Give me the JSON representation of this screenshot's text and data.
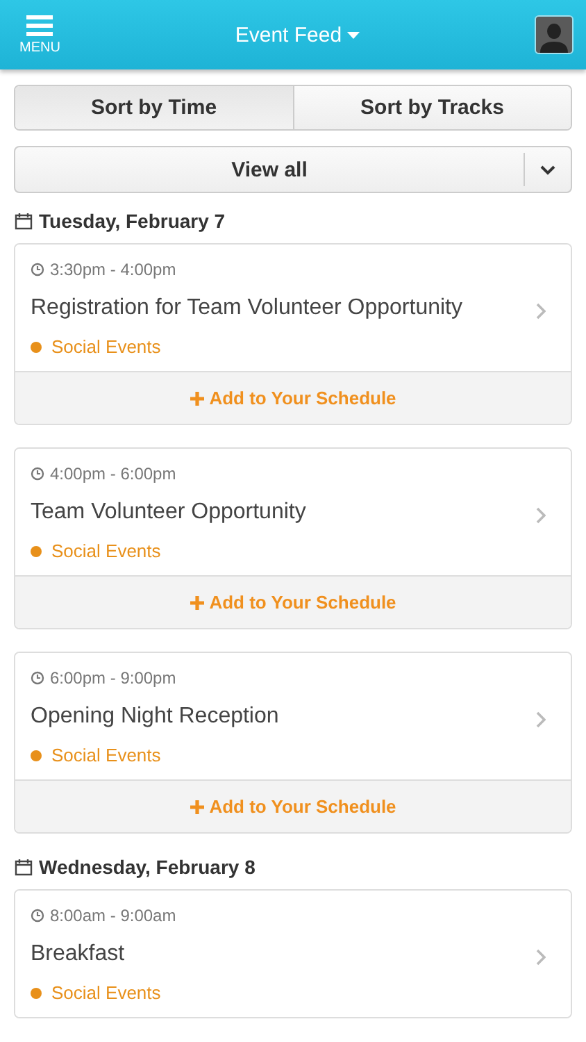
{
  "header": {
    "menu_label": "MENU",
    "title": "Event Feed"
  },
  "sort_tabs": [
    {
      "label": "Sort by Time",
      "selected": true
    },
    {
      "label": "Sort by Tracks",
      "selected": false
    }
  ],
  "filter": {
    "value": "View all"
  },
  "days": [
    {
      "date": "Tuesday, February 7",
      "events": [
        {
          "time": "3:30pm - 4:00pm",
          "title": "Registration for Team Volunteer Opportunity",
          "track": "Social Events",
          "color": "#e8901a",
          "action": "Add to Your Schedule"
        },
        {
          "time": "4:00pm - 6:00pm",
          "title": "Team Volunteer Opportunity",
          "track": "Social Events",
          "color": "#e8901a",
          "action": "Add to Your Schedule"
        },
        {
          "time": "6:00pm - 9:00pm",
          "title": "Opening Night Reception",
          "track": "Social Events",
          "color": "#e8901a",
          "action": "Add to Your Schedule"
        }
      ]
    },
    {
      "date": "Wednesday, February 8",
      "events": [
        {
          "time": "8:00am - 9:00am",
          "title": "Breakfast",
          "track": "Social Events",
          "color": "#e8901a"
        }
      ]
    }
  ]
}
